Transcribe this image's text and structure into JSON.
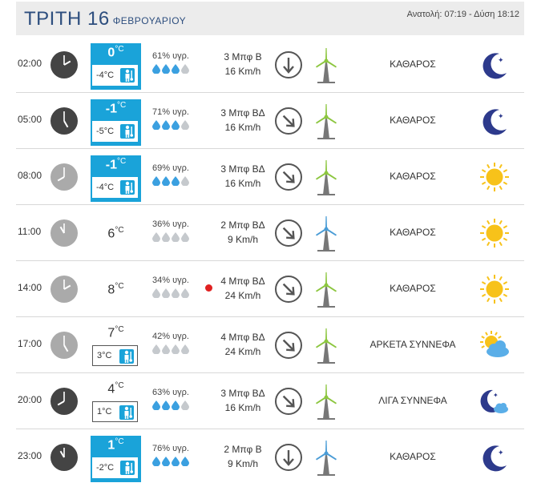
{
  "header": {
    "day": "ΤΡΙΤΗ 16",
    "month": "ΦΕΒΡΟΥΑΡΙΟΥ",
    "sun": "Ανατολή: 07:19 - Δύση 18:12"
  },
  "colors": {
    "accent": "#1aa3d9",
    "title": "#2d4e7e",
    "drop_full": "#3ba0e0",
    "drop_empty": "#c5c9cd",
    "turbine_green": "#8cc63f",
    "turbine_blue": "#4a9cd6",
    "moon": "#2d3a8c",
    "sun": "#f7c21a"
  },
  "rows": [
    {
      "time": "02:00",
      "clock": "night",
      "hour": 2,
      "temp": "0",
      "feel": "-4°C",
      "style": "blue",
      "humidity": "61% υγρ.",
      "drops": 3,
      "bft": "3 Μπφ Β",
      "kmh": "16 Km/h",
      "dir": "S",
      "turbine": "green",
      "condition": "ΚΑΘΑΡΟΣ",
      "icon": "moon"
    },
    {
      "time": "05:00",
      "clock": "night",
      "hour": 5,
      "temp": "-1",
      "feel": "-5°C",
      "style": "blue",
      "humidity": "71% υγρ.",
      "drops": 3,
      "bft": "3 Μπφ ΒΔ",
      "kmh": "16 Km/h",
      "dir": "SE",
      "turbine": "green",
      "condition": "ΚΑΘΑΡΟΣ",
      "icon": "moon"
    },
    {
      "time": "08:00",
      "clock": "day",
      "hour": 8,
      "temp": "-1",
      "feel": "-4°C",
      "style": "blue",
      "humidity": "69% υγρ.",
      "drops": 3,
      "bft": "3 Μπφ ΒΔ",
      "kmh": "16 Km/h",
      "dir": "SE",
      "turbine": "green",
      "condition": "ΚΑΘΑΡΟΣ",
      "icon": "sun"
    },
    {
      "time": "11:00",
      "clock": "day",
      "hour": 11,
      "temp": "6",
      "feel": "",
      "style": "plain",
      "humidity": "36% υγρ.",
      "drops": 0,
      "bft": "2 Μπφ ΒΔ",
      "kmh": "9 Km/h",
      "dir": "SE",
      "turbine": "blue",
      "condition": "ΚΑΘΑΡΟΣ",
      "icon": "sun"
    },
    {
      "time": "14:00",
      "clock": "day",
      "hour": 2,
      "temp": "8",
      "feel": "",
      "style": "plain",
      "dot": true,
      "humidity": "34% υγρ.",
      "drops": 0,
      "bft": "4 Μπφ ΒΔ",
      "kmh": "24 Km/h",
      "dir": "SE",
      "turbine": "green",
      "condition": "ΚΑΘΑΡΟΣ",
      "icon": "sun"
    },
    {
      "time": "17:00",
      "clock": "day",
      "hour": 5,
      "temp": "7",
      "feel": "3°C",
      "style": "outline",
      "humidity": "42% υγρ.",
      "drops": 0,
      "bft": "4 Μπφ ΒΔ",
      "kmh": "24 Km/h",
      "dir": "SE",
      "turbine": "green",
      "condition": "ΑΡΚΕΤΑ ΣΥΝΝΕΦΑ",
      "icon": "sun-cloud"
    },
    {
      "time": "20:00",
      "clock": "night",
      "hour": 8,
      "temp": "4",
      "feel": "1°C",
      "style": "outline",
      "humidity": "63% υγρ.",
      "drops": 3,
      "bft": "3 Μπφ ΒΔ",
      "kmh": "16 Km/h",
      "dir": "SE",
      "turbine": "green",
      "condition": "ΛΙΓΑ ΣΥΝΝΕΦΑ",
      "icon": "moon-cloud"
    },
    {
      "time": "23:00",
      "clock": "night",
      "hour": 11,
      "temp": "1",
      "feel": "-2°C",
      "style": "blue",
      "humidity": "76% υγρ.",
      "drops": 4,
      "bft": "2 Μπφ Β",
      "kmh": "9 Km/h",
      "dir": "S",
      "turbine": "blue",
      "condition": "ΚΑΘΑΡΟΣ",
      "icon": "moon"
    }
  ]
}
